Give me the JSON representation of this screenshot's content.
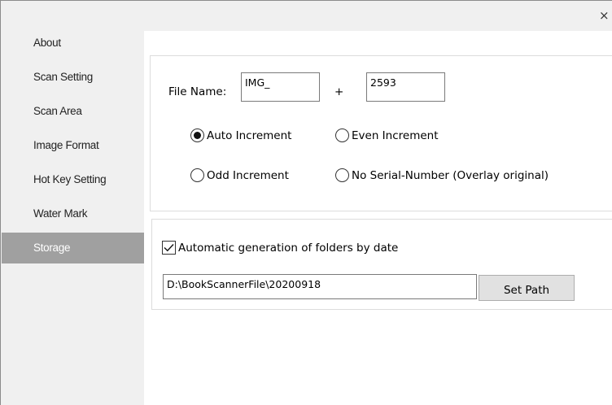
{
  "window": {
    "close_glyph": "×"
  },
  "sidebar": {
    "items": [
      {
        "label": "About"
      },
      {
        "label": "Scan Setting"
      },
      {
        "label": "Scan Area"
      },
      {
        "label": "Image Format"
      },
      {
        "label": "Hot Key Setting"
      },
      {
        "label": "Water Mark"
      },
      {
        "label": "Storage"
      }
    ],
    "active_index": 6
  },
  "storage": {
    "file_name_label": "File Name:",
    "prefix_value": "IMG_",
    "plus_label": "+",
    "number_value": "2593",
    "radios": {
      "auto": {
        "label": "Auto Increment",
        "checked": true
      },
      "even": {
        "label": "Even Increment",
        "checked": false
      },
      "odd": {
        "label": "Odd Increment",
        "checked": false
      },
      "none": {
        "label": "No Serial-Number (Overlay original)",
        "checked": false
      }
    },
    "auto_folder": {
      "label": "Automatic generation of folders by date",
      "checked": true
    },
    "path_value": "D:\\BookScannerFile\\20200918",
    "set_path_label": "Set Path"
  },
  "colors": {
    "active_nav_bg": "#a0a0a0",
    "content_bg": "#ffffff",
    "window_bg": "#f0f0f0"
  },
  "icons": {
    "close": "close-icon",
    "check": "check-icon"
  }
}
